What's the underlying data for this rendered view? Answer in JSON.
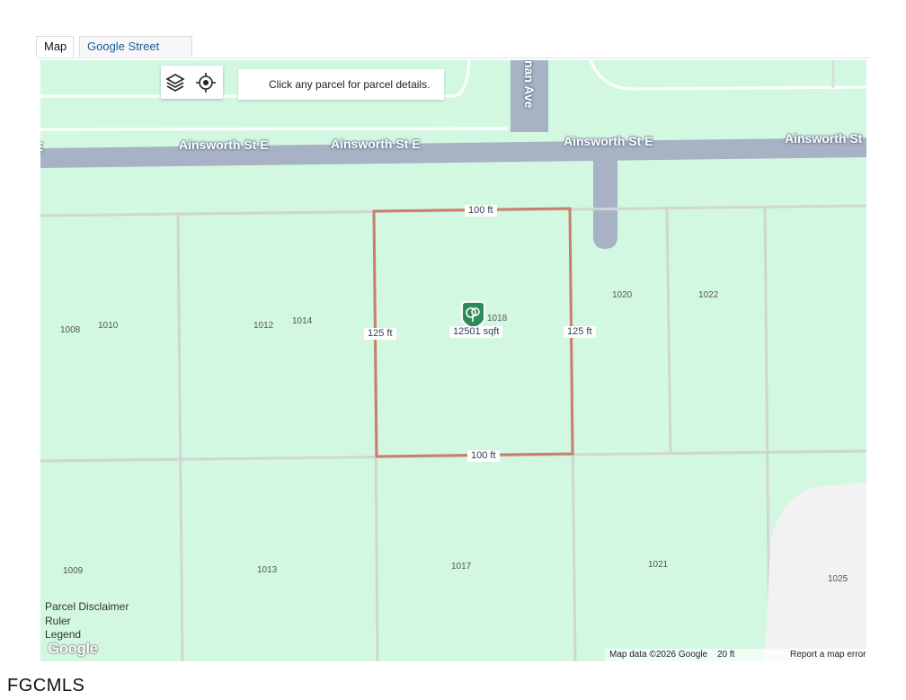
{
  "tabs": [
    {
      "label": "Map"
    },
    {
      "label": "Google Street View"
    }
  ],
  "map": {
    "controls": {
      "layers_icon": "layers-icon",
      "locate_icon": "crosshair-icon"
    },
    "hint": "Click any parcel for parcel details.",
    "streets": {
      "horizontal": [
        "Ainsworth St E",
        "Ainsworth St E",
        "Ainsworth St E",
        "Ainsworth St E",
        "Ainsworth St"
      ],
      "vertical": "nan Ave"
    },
    "lots": [
      "1008",
      "1010",
      "1012",
      "1014",
      "1018",
      "1020",
      "1022",
      "1009",
      "1013",
      "1017",
      "1021",
      "1025"
    ],
    "selected_parcel": {
      "icon": "tree-marker-icon",
      "area": "12501 sqft",
      "top_dim": "100 ft",
      "bottom_dim": "100 ft",
      "left_dim": "125 ft",
      "right_dim": "125 ft",
      "border_color": "#c97f6a"
    },
    "overlay_links": [
      "Parcel Disclaimer",
      "Ruler",
      "Legend"
    ],
    "google_logo": "Google",
    "attribution": {
      "data": "Map data ©2026 Google",
      "scale": "20 ft",
      "report": "Report a map error"
    }
  },
  "footer": {
    "logo": "FGCMLS"
  },
  "colors": {
    "map_bg": "#d3f8e2",
    "road": "#a7b3c4",
    "parcel_line": "#cfd6d2"
  }
}
